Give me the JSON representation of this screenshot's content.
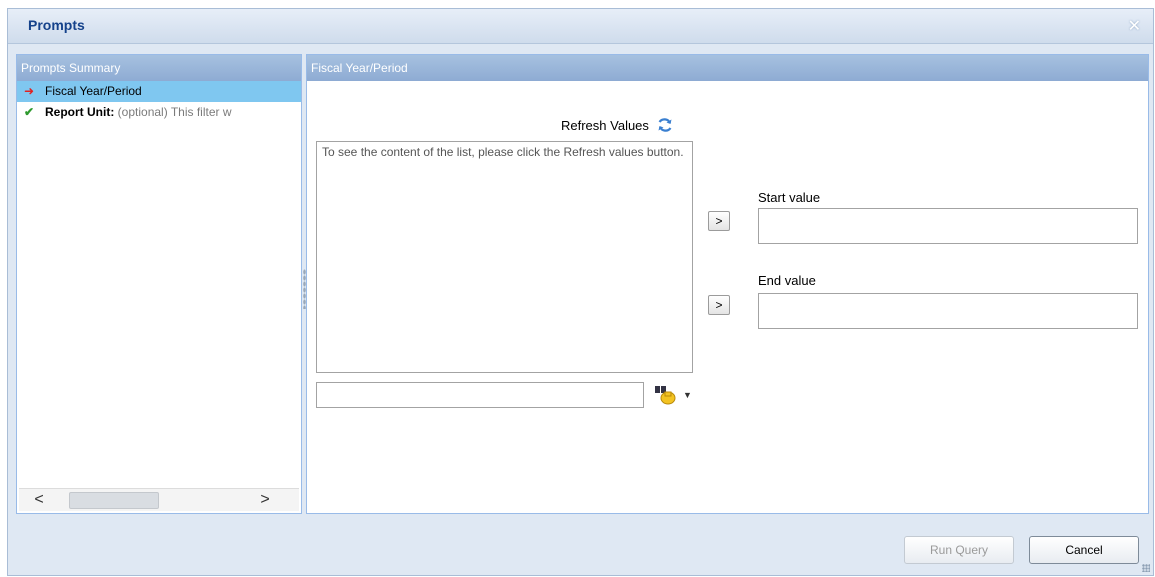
{
  "dialog": {
    "title": "Prompts",
    "close_glyph": "✕"
  },
  "summary": {
    "header": "Prompts Summary",
    "items": [
      {
        "label": "Fiscal Year/Period",
        "icon": "red-arrow-icon",
        "selected": true
      },
      {
        "label": "Report Unit:",
        "optional_text": "(optional) This filter w",
        "icon": "green-check-icon"
      }
    ],
    "scroll_left": "<",
    "scroll_right": ">"
  },
  "detail": {
    "header": "Fiscal Year/Period",
    "refresh_label": "Refresh Values",
    "list_message": "To see the content of the list, please click the Refresh values button.",
    "search_value": "",
    "start_label": "Start value",
    "end_label": "End value",
    "start_value": "",
    "end_value": "",
    "arrow_label": ">"
  },
  "buttons": {
    "run_query": "Run Query",
    "cancel": "Cancel"
  },
  "colors": {
    "selected_row": "#7fc7f0",
    "panel_header": "#8eabd3",
    "title_text": "#15428b"
  }
}
